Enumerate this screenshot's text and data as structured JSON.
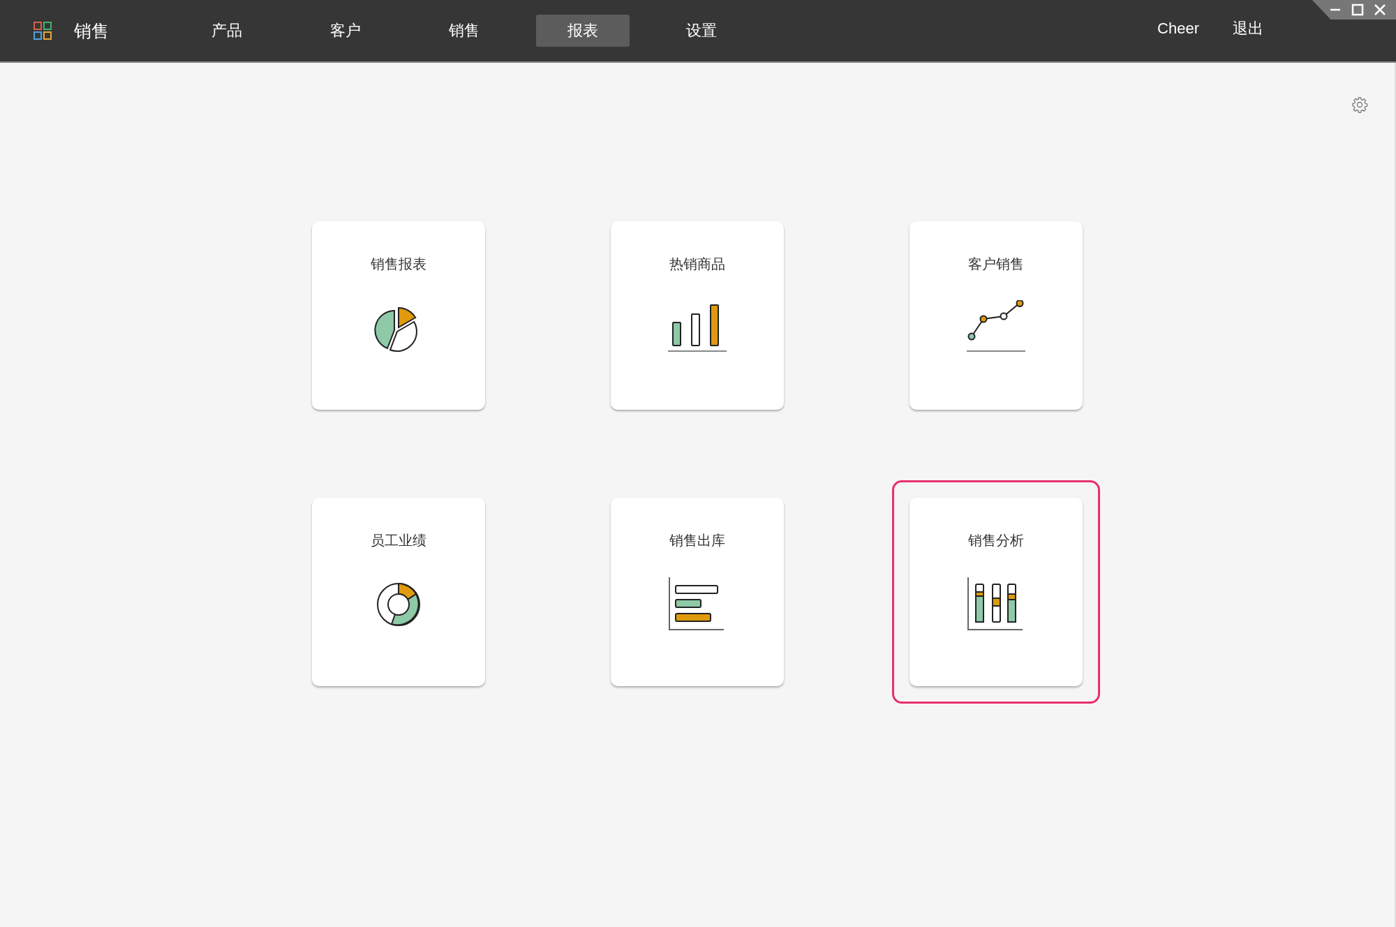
{
  "app": {
    "title": "销售"
  },
  "nav": [
    {
      "label": "产品",
      "selected": false
    },
    {
      "label": "客户",
      "selected": false
    },
    {
      "label": "销售",
      "selected": false
    },
    {
      "label": "报表",
      "selected": true
    },
    {
      "label": "设置",
      "selected": false
    }
  ],
  "user": {
    "name": "Cheer",
    "logout": "退出"
  },
  "reports": [
    {
      "title": "销售报表",
      "kind": "pie",
      "selected": false
    },
    {
      "title": "热销商品",
      "kind": "bars",
      "selected": false
    },
    {
      "title": "客户销售",
      "kind": "line",
      "selected": false
    },
    {
      "title": "员工业绩",
      "kind": "donut",
      "selected": false
    },
    {
      "title": "销售出库",
      "kind": "hbars",
      "selected": false
    },
    {
      "title": "销售分析",
      "kind": "stacked",
      "selected": true
    }
  ]
}
